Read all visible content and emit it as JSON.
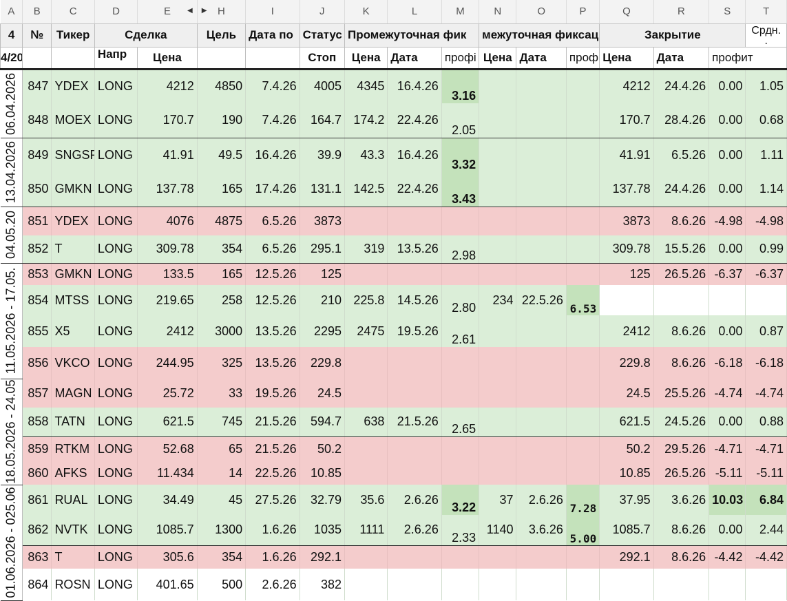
{
  "colHeaders": [
    "A",
    "B",
    "C",
    "D",
    "E",
    "H",
    "I",
    "J",
    "K",
    "L",
    "M",
    "N",
    "O",
    "P",
    "Q",
    "R",
    "S",
    "T"
  ],
  "header1": {
    "a": "4",
    "b": "№",
    "c": "Тикер",
    "de": "Сделка",
    "h": "Цель",
    "i": "Дата по",
    "j": "Статус",
    "klm": "Промежуточная фик",
    "nop": "межуточная фиксац",
    "qrs": "Закрытие",
    "t": "Срдн.",
    "t2": "."
  },
  "header2": {
    "a": "4/20",
    "d": "Напр",
    "e": "Цена",
    "j": "Стоп",
    "k": "Цена",
    "l": "Дата",
    "m": "профі",
    "n": "Цена",
    "o": "Дата",
    "p": "проф",
    "q": "Цена",
    "r": "Дата",
    "s": "профит"
  },
  "groups": [
    {
      "label": "06.04.2026"
    },
    {
      "label": "13.04.2026"
    },
    {
      "label": "04.05.20"
    },
    {
      "label": "11.05.2026 - 17.05."
    },
    {
      "label": "18.05.2026 - 24.05"
    },
    {
      "label": "01.06.2026 - 025.06"
    }
  ],
  "rows": [
    {
      "b": "847",
      "c": "YDEX",
      "d": "LONG",
      "e": "4212",
      "h": "4850",
      "i": "7.4.26",
      "j": "4005",
      "k": "4345",
      "l": "16.4.26",
      "m": "3.16",
      "n": "",
      "o": "",
      "p": "",
      "q": "4212",
      "r": "24.4.26",
      "s": "0.00",
      "t": "1.05"
    },
    {
      "b": "848",
      "c": "MOEX",
      "d": "LONG",
      "e": "170.7",
      "h": "190",
      "i": "7.4.26",
      "j": "164.7",
      "k": "174.2",
      "l": "22.4.26",
      "m": "2.05",
      "n": "",
      "o": "",
      "p": "",
      "q": "170.7",
      "r": "28.4.26",
      "s": "0.00",
      "t": "0.68"
    },
    {
      "b": "849",
      "c": "SNGSP",
      "d": "LONG",
      "e": "41.91",
      "h": "49.5",
      "i": "16.4.26",
      "j": "39.9",
      "k": "43.3",
      "l": "16.4.26",
      "m": "3.32",
      "n": "",
      "o": "",
      "p": "",
      "q": "41.91",
      "r": "6.5.26",
      "s": "0.00",
      "t": "1.11"
    },
    {
      "b": "850",
      "c": "GMKN",
      "d": "LONG",
      "e": "137.78",
      "h": "165",
      "i": "17.4.26",
      "j": "131.1",
      "k": "142.5",
      "l": "22.4.26",
      "m": "3.43",
      "n": "",
      "o": "",
      "p": "",
      "q": "137.78",
      "r": "24.4.26",
      "s": "0.00",
      "t": "1.14"
    },
    {
      "b": "851",
      "c": "YDEX",
      "d": "LONG",
      "e": "4076",
      "h": "4875",
      "i": "6.5.26",
      "j": "3873",
      "k": "",
      "l": "",
      "m": "",
      "n": "",
      "o": "",
      "p": "",
      "q": "3873",
      "r": "8.6.26",
      "s": "-4.98",
      "t": "-4.98"
    },
    {
      "b": "852",
      "c": "T",
      "d": "LONG",
      "e": "309.78",
      "h": "354",
      "i": "6.5.26",
      "j": "295.1",
      "k": "319",
      "l": "13.5.26",
      "m": "2.98",
      "n": "",
      "o": "",
      "p": "",
      "q": "309.78",
      "r": "15.5.26",
      "s": "0.00",
      "t": "0.99"
    },
    {
      "b": "853",
      "c": "GMKN",
      "d": "LONG",
      "e": "133.5",
      "h": "165",
      "i": "12.5.26",
      "j": "125",
      "k": "",
      "l": "",
      "m": "",
      "n": "",
      "o": "",
      "p": "",
      "q": "125",
      "r": "26.5.26",
      "s": "-6.37",
      "t": "-6.37"
    },
    {
      "b": "854",
      "c": "MTSS",
      "d": "LONG",
      "e": "219.65",
      "h": "258",
      "i": "12.5.26",
      "j": "210",
      "k": "225.8",
      "l": "14.5.26",
      "m": "2.80",
      "n": "234",
      "o": "22.5.26",
      "p": "6.53",
      "q": "",
      "r": "",
      "s": "",
      "t": ""
    },
    {
      "b": "855",
      "c": "X5",
      "d": "LONG",
      "e": "2412",
      "h": "3000",
      "i": "13.5.26",
      "j": "2295",
      "k": "2475",
      "l": "19.5.26",
      "m": "2.61",
      "n": "",
      "o": "",
      "p": "",
      "q": "2412",
      "r": "8.6.26",
      "s": "0.00",
      "t": "0.87"
    },
    {
      "b": "856",
      "c": "VKCO",
      "d": "LONG",
      "e": "244.95",
      "h": "325",
      "i": "13.5.26",
      "j": "229.8",
      "k": "",
      "l": "",
      "m": "",
      "n": "",
      "o": "",
      "p": "",
      "q": "229.8",
      "r": "8.6.26",
      "s": "-6.18",
      "t": "-6.18"
    },
    {
      "b": "857",
      "c": "MAGN",
      "d": "LONG",
      "e": "25.72",
      "h": "33",
      "i": "19.5.26",
      "j": "24.5",
      "k": "",
      "l": "",
      "m": "",
      "n": "",
      "o": "",
      "p": "",
      "q": "24.5",
      "r": "25.5.26",
      "s": "-4.74",
      "t": "-4.74"
    },
    {
      "b": "858",
      "c": "TATN",
      "d": "LONG",
      "e": "621.5",
      "h": "745",
      "i": "21.5.26",
      "j": "594.7",
      "k": "638",
      "l": "21.5.26",
      "m": "2.65",
      "n": "",
      "o": "",
      "p": "",
      "q": "621.5",
      "r": "24.5.26",
      "s": "0.00",
      "t": "0.88"
    },
    {
      "b": "859",
      "c": "RTKM",
      "d": "LONG",
      "e": "52.68",
      "h": "65",
      "i": "21.5.26",
      "j": "50.2",
      "k": "",
      "l": "",
      "m": "",
      "n": "",
      "o": "",
      "p": "",
      "q": "50.2",
      "r": "29.5.26",
      "s": "-4.71",
      "t": "-4.71"
    },
    {
      "b": "860",
      "c": "AFKS",
      "d": "LONG",
      "e": "11.434",
      "h": "14",
      "i": "22.5.26",
      "j": "10.85",
      "k": "",
      "l": "",
      "m": "",
      "n": "",
      "o": "",
      "p": "",
      "q": "10.85",
      "r": "26.5.26",
      "s": "-5.11",
      "t": "-5.11"
    },
    {
      "b": "861",
      "c": "RUAL",
      "d": "LONG",
      "e": "34.49",
      "h": "45",
      "i": "27.5.26",
      "j": "32.79",
      "k": "35.6",
      "l": "2.6.26",
      "m": "3.22",
      "n": "37",
      "o": "2.6.26",
      "p": "7.28",
      "q": "37.95",
      "r": "3.6.26",
      "s": "10.03",
      "t": "6.84"
    },
    {
      "b": "862",
      "c": "NVTK",
      "d": "LONG",
      "e": "1085.7",
      "h": "1300",
      "i": "1.6.26",
      "j": "1035",
      "k": "1111",
      "l": "2.6.26",
      "m": "2.33",
      "n": "1140",
      "o": "3.6.26",
      "p": "5.00",
      "q": "1085.7",
      "r": "8.6.26",
      "s": "0.00",
      "t": "2.44"
    },
    {
      "b": "863",
      "c": "T",
      "d": "LONG",
      "e": "305.6",
      "h": "354",
      "i": "1.6.26",
      "j": "292.1",
      "k": "",
      "l": "",
      "m": "",
      "n": "",
      "o": "",
      "p": "",
      "q": "292.1",
      "r": "8.6.26",
      "s": "-4.42",
      "t": "-4.42"
    },
    {
      "b": "864",
      "c": "ROSN",
      "d": "LONG",
      "e": "401.65",
      "h": "500",
      "i": "2.6.26",
      "j": "382",
      "k": "",
      "l": "",
      "m": "",
      "n": "",
      "o": "",
      "p": "",
      "q": "",
      "r": "",
      "s": "",
      "t": ""
    }
  ],
  "colors": {
    "profit_fill": "#dbeed8",
    "loss_fill": "#f4cccc",
    "highlight_fill": "#c4e2bb"
  }
}
